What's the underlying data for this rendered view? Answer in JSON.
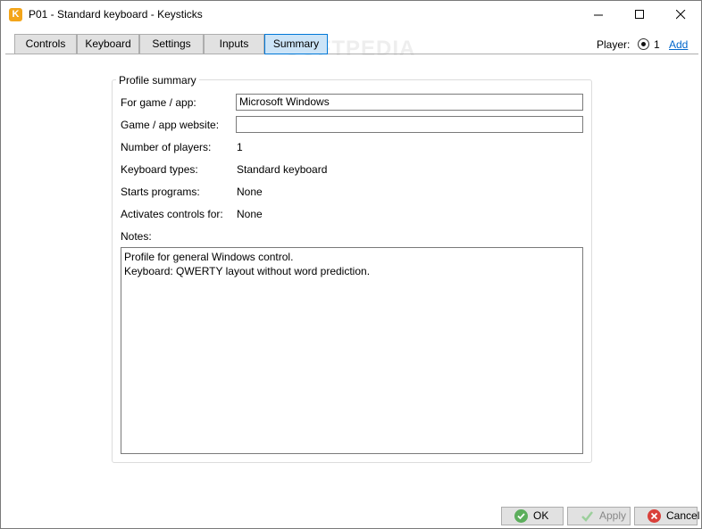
{
  "window": {
    "title": "P01 - Standard keyboard - Keysticks",
    "app_icon_letter": "K",
    "accent_color": "#f3a51a"
  },
  "tabs": [
    {
      "label": "Controls",
      "active": false
    },
    {
      "label": "Keyboard",
      "active": false
    },
    {
      "label": "Settings",
      "active": false
    },
    {
      "label": "Inputs",
      "active": false
    },
    {
      "label": "Summary",
      "active": true
    }
  ],
  "player": {
    "label": "Player:",
    "selected": "1",
    "add_label": "Add"
  },
  "summary": {
    "group_title": "Profile summary",
    "game_app_label": "For game / app:",
    "game_app_value": "Microsoft Windows",
    "website_label": "Game / app website:",
    "website_value": "",
    "players_label": "Number of players:",
    "players_value": "1",
    "keyboard_types_label": "Keyboard types:",
    "keyboard_types_value": "Standard keyboard",
    "starts_programs_label": "Starts programs:",
    "starts_programs_value": "None",
    "activates_label": "Activates controls for:",
    "activates_value": "None",
    "notes_label": "Notes:",
    "notes_line1": "Profile for general Windows control.",
    "notes_line2": "Keyboard: QWERTY layout without word prediction."
  },
  "watermark": "SOFTPEDIA",
  "buttons": {
    "ok_label": "OK",
    "apply_label": "Apply",
    "cancel_label": "Cancel"
  },
  "icons": {
    "ok": "check-circle-icon",
    "apply": "check-icon",
    "cancel": "x-circle-icon"
  }
}
